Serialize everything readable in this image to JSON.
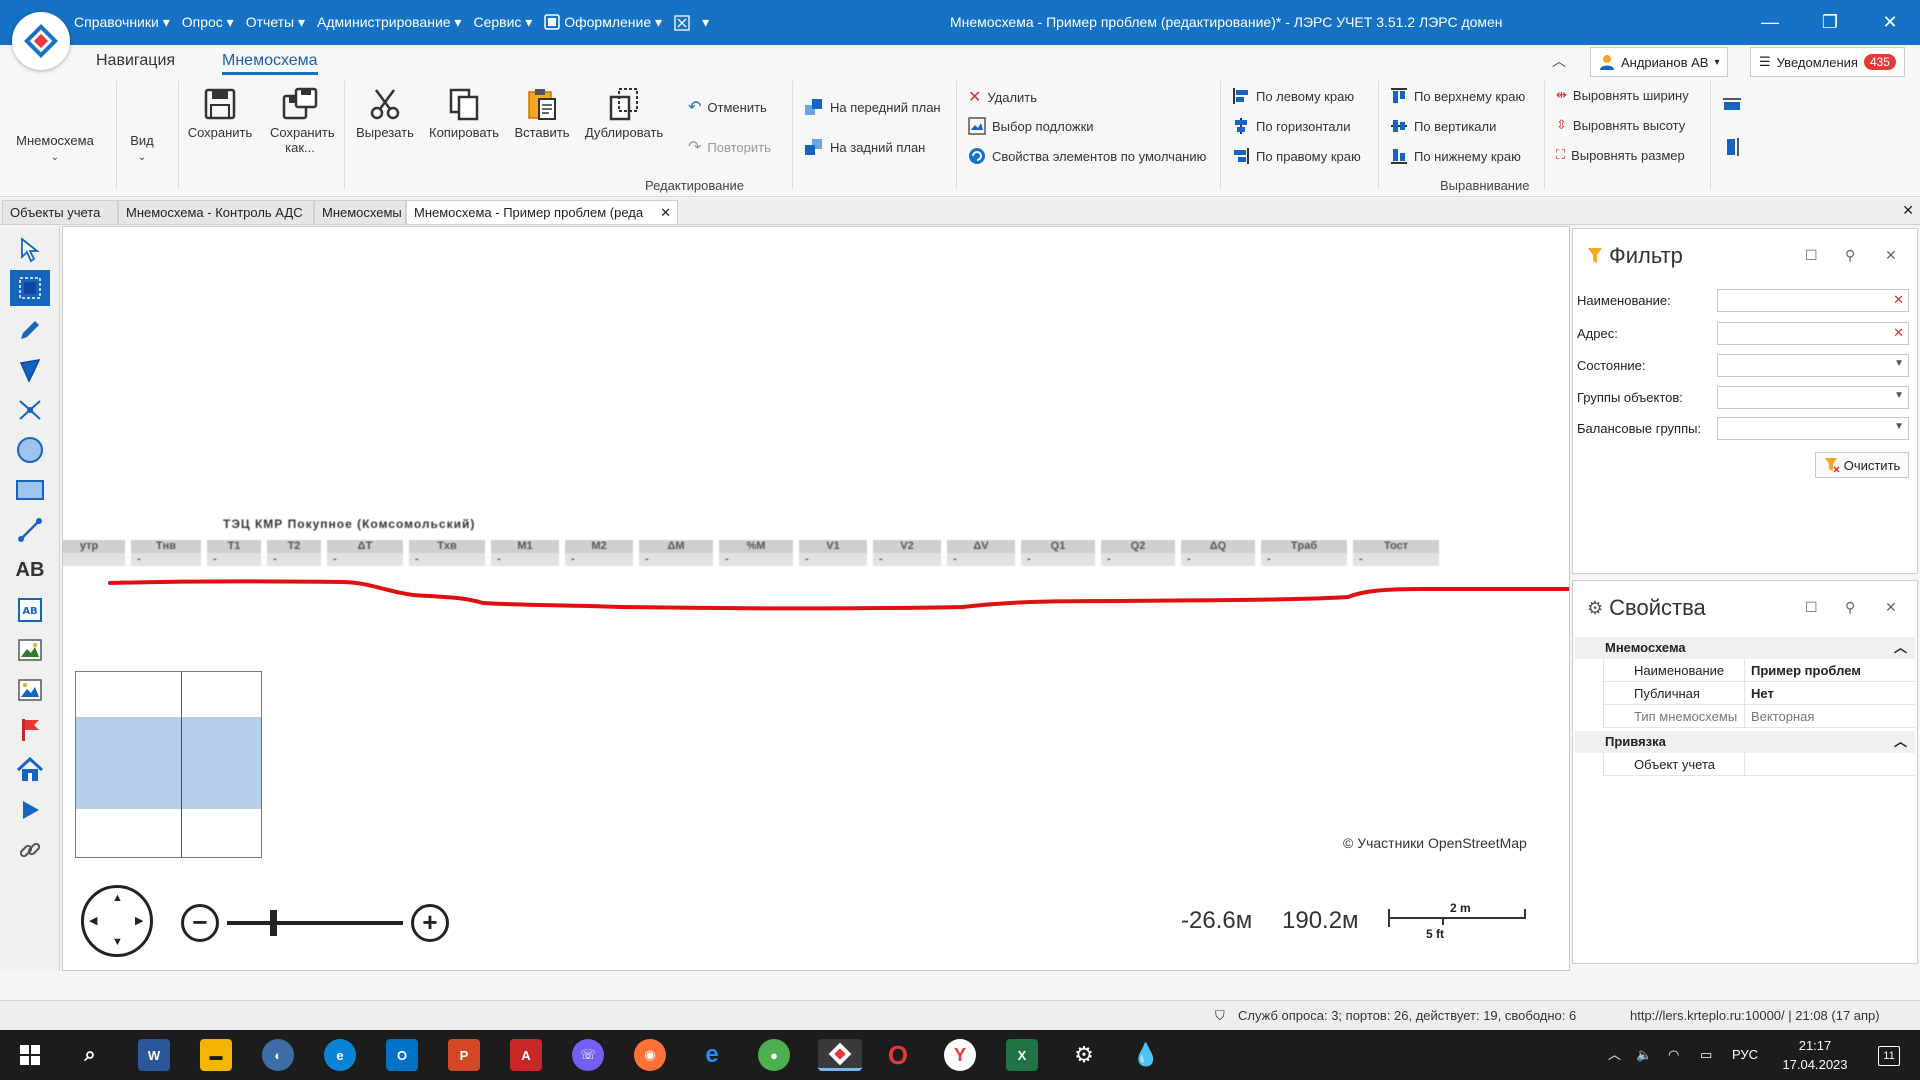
{
  "menu": {
    "items": [
      "Справочники",
      "Опрос",
      "Отчеты",
      "Администрирование",
      "Сервис",
      "Оформление"
    ]
  },
  "window": {
    "title": "Мнемосхема - Пример проблем (редактирование)* - ЛЭРС УЧЕТ 3.51.2 ЛЭРС домен"
  },
  "ribbon": {
    "tabs": [
      "Навигация",
      "Мнемосхема"
    ],
    "mnemo_label": "Мнемосхема",
    "view_label": "Вид",
    "save": "Сохранить",
    "save_as": "Сохранить как...",
    "cut": "Вырезать",
    "copy": "Копировать",
    "paste": "Вставить",
    "duplicate": "Дублировать",
    "undo": "Отменить",
    "redo": "Повторить",
    "front": "На передний план",
    "back": "На задний план",
    "delete": "Удалить",
    "backdrop": "Выбор подложки",
    "defaults": "Свойства элементов по умолчанию",
    "group_edit": "Редактирование",
    "align_left": "По левому краю",
    "align_hcenter": "По горизонтали",
    "align_right": "По правому краю",
    "align_top": "По верхнему краю",
    "align_vcenter": "По вертикали",
    "align_bottom": "По нижнему краю",
    "same_width": "Выровнять ширину",
    "same_height": "Выровнять высоту",
    "same_size": "Выровнять размер",
    "group_align": "Выравнивание",
    "user": "Андрианов АВ",
    "notifications": "Уведомления",
    "notif_count": "435"
  },
  "doctabs": [
    "Объекты учета",
    "Мнемосхема - Контроль АДС",
    "Мнемосхемы",
    "Мнемосхема - Пример проблем (реда"
  ],
  "canvas": {
    "obj_title": "ТЭЦ КМР Покупное (Комсомольский)",
    "columns": [
      "утр",
      "Тнв",
      "T1",
      "T2",
      "ΔT",
      "Txв",
      "M1",
      "M2",
      "ΔM",
      "%M",
      "V1",
      "V2",
      "ΔV",
      "Q1",
      "Q2",
      "ΔQ",
      "Tраб",
      "Тост"
    ],
    "cell_value": "-",
    "attribution": "© Участники OpenStreetMap",
    "coord_x": "-26.6м",
    "coord_y": "190.2м",
    "scale_top": "2 m",
    "scale_bottom": "5 ft",
    "zoom_level": 0.25
  },
  "filter": {
    "title": "Фильтр",
    "name_label": "Наименование:",
    "address_label": "Адрес:",
    "state_label": "Состояние:",
    "groups_label": "Группы объектов:",
    "balance_label": "Балансовые группы:",
    "clear": "Очистить"
  },
  "properties": {
    "title": "Свойства",
    "cat1": "Мнемосхема",
    "name_key": "Наименование",
    "name_val": "Пример проблем",
    "public_key": "Публичная",
    "public_val": "Нет",
    "type_key": "Тип мнемосхемы",
    "type_val": "Векторная",
    "cat2": "Привязка",
    "obj_key": "Объект учета"
  },
  "status": {
    "services": "Служб опроса: 3; портов: 26, действует: 19, свободно: 6",
    "server": "http://lers.krteplo.ru:10000/ | 21:08 (17 апр)"
  },
  "taskbar": {
    "lang": "РУС",
    "time": "21:17",
    "date": "17.04.2023",
    "notif": "11"
  },
  "colors": {
    "accent": "#1572c4",
    "red_line": "#e01010"
  }
}
